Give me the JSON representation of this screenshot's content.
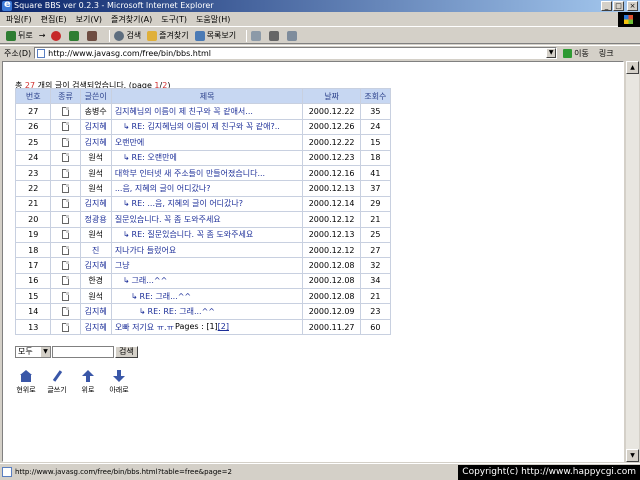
{
  "window": {
    "title": "Square BBS ver 0.2.3 - Microsoft Internet Explorer",
    "buttons": {
      "minimize": "_",
      "maximize": "□",
      "close": "×"
    }
  },
  "menu": [
    "파일(F)",
    "편집(E)",
    "보기(V)",
    "즐겨찾기(A)",
    "도구(T)",
    "도움말(H)"
  ],
  "toolbar": {
    "back": "뒤로",
    "forward": "→",
    "search": "검색",
    "favorites": "즐겨찾기",
    "history": "목록보기"
  },
  "address": {
    "label": "주소(D)",
    "url": "http://www.javasg.com/free/bin/bbs.html",
    "go": "이동",
    "links": "링크"
  },
  "board": {
    "summary_prefix": "총 ",
    "total": "27",
    "summary_mid": " 개의 글이 검색되었습니다. (page ",
    "page_current": "1",
    "page_sep": "/",
    "page_total": "2",
    "summary_end": ")",
    "headers": [
      "번호",
      "종류",
      "글쓴이",
      "제목",
      "날짜",
      "조회수"
    ],
    "rows": [
      {
        "num": "27",
        "author": "송병수",
        "author_link": false,
        "reply": 0,
        "title": "김지혜님의 이름이 제 친구와 꼭 같애서...",
        "date": "2000.12.22",
        "views": "35"
      },
      {
        "num": "26",
        "author": "김지혜",
        "author_link": true,
        "reply": 1,
        "title": "RE: 김지혜님의 이름이 제 친구와 꼭 같애?..",
        "date": "2000.12.26",
        "views": "24"
      },
      {
        "num": "25",
        "author": "김지혜",
        "author_link": true,
        "reply": 0,
        "title": "오랜만에",
        "date": "2000.12.22",
        "views": "15"
      },
      {
        "num": "24",
        "author": "원석",
        "author_link": false,
        "reply": 1,
        "title": "RE: 오랜만에",
        "date": "2000.12.23",
        "views": "18"
      },
      {
        "num": "23",
        "author": "원석",
        "author_link": false,
        "reply": 0,
        "title": "대학부 인터넷 새 주소들이 만들어졌습니다...",
        "date": "2000.12.16",
        "views": "41"
      },
      {
        "num": "22",
        "author": "원석",
        "author_link": false,
        "reply": 0,
        "title": "...음, 지혜의 글이 어디갔나?",
        "date": "2000.12.13",
        "views": "37"
      },
      {
        "num": "21",
        "author": "김지혜",
        "author_link": true,
        "reply": 1,
        "title": "RE: ...음, 지혜의 글이 어디갔나?",
        "date": "2000.12.14",
        "views": "29"
      },
      {
        "num": "20",
        "author": "정광용",
        "author_link": true,
        "reply": 0,
        "title": "질문있습니다. 꼭 좀 도와주세요",
        "date": "2000.12.12",
        "views": "21"
      },
      {
        "num": "19",
        "author": "원석",
        "author_link": false,
        "reply": 1,
        "title": "RE: 질문있습니다. 꼭 좀 도와주세요",
        "date": "2000.12.13",
        "views": "25"
      },
      {
        "num": "18",
        "author": "진",
        "author_link": true,
        "reply": 0,
        "title": "지나가다 들렀어요",
        "date": "2000.12.12",
        "views": "27"
      },
      {
        "num": "17",
        "author": "김지혜",
        "author_link": true,
        "reply": 0,
        "title": "그냥",
        "date": "2000.12.08",
        "views": "32"
      },
      {
        "num": "16",
        "author": "한경",
        "author_link": false,
        "reply": 1,
        "title": "그래...^^",
        "date": "2000.12.08",
        "views": "34"
      },
      {
        "num": "15",
        "author": "원석",
        "author_link": false,
        "reply": 2,
        "title": "RE: 그래...^^",
        "date": "2000.12.08",
        "views": "21"
      },
      {
        "num": "14",
        "author": "김지혜",
        "author_link": true,
        "reply": 3,
        "title": "RE: RE: 그래...^^",
        "date": "2000.12.09",
        "views": "23"
      },
      {
        "num": "13",
        "author": "김지혜",
        "author_link": true,
        "reply": 0,
        "title": "오빠 저기요 ㅠ.ㅠ",
        "date": "2000.11.27",
        "views": "60"
      }
    ],
    "pages_label": "Pages : ",
    "page1": "[1]",
    "page2": "[2]"
  },
  "search": {
    "field_option": "모두",
    "button": "검색"
  },
  "nav": {
    "home": "현위로",
    "write": "글쓰기",
    "up": "위로",
    "down": "아래로"
  },
  "status": {
    "url": "http://www.javasg.com/free/bin/bbs.html?table=free&page=2",
    "copyright": "Copyright(c) http://www.happycgi.com"
  }
}
